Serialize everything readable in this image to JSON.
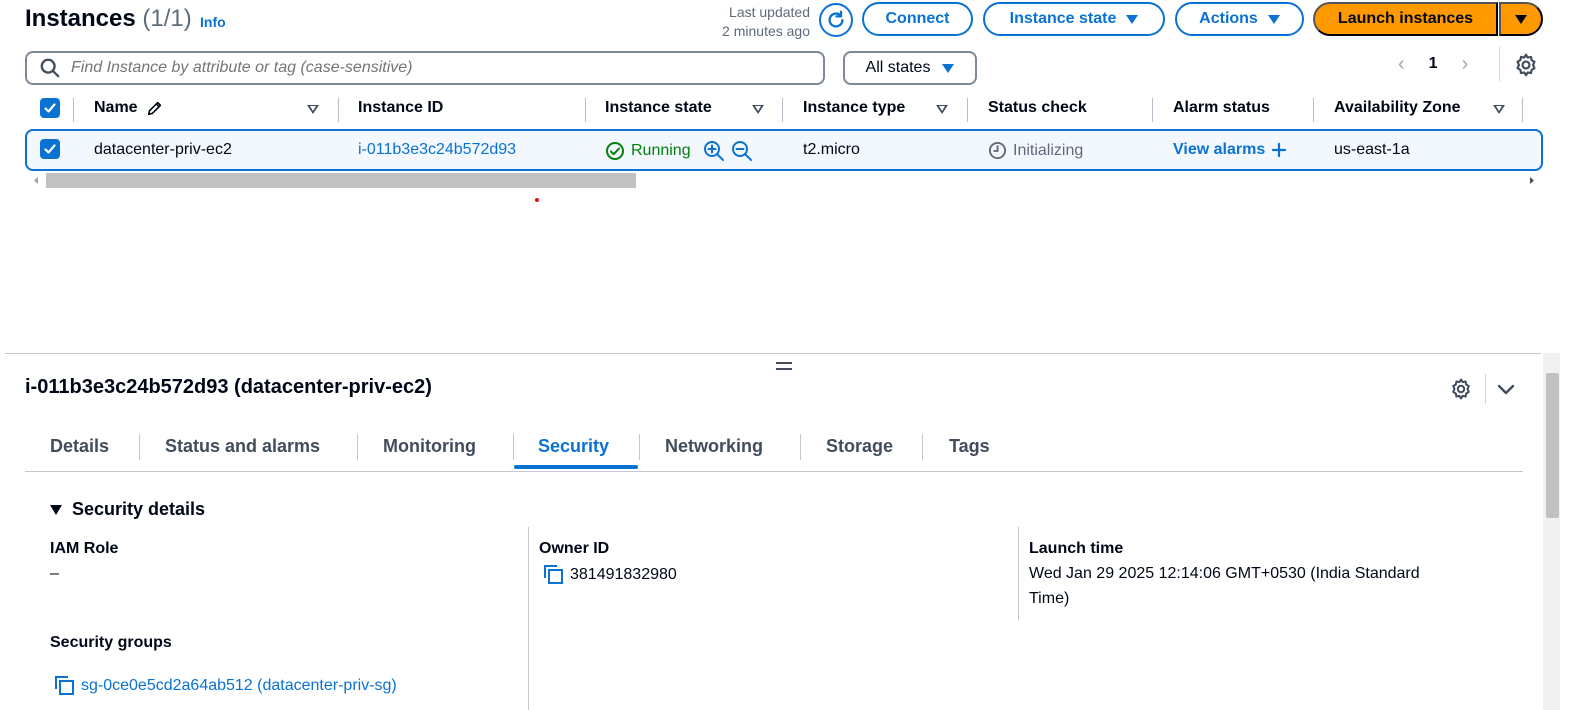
{
  "header": {
    "title": "Instances",
    "count": "(1/1)",
    "info": "Info",
    "last_updated_line1": "Last updated",
    "last_updated_line2": "2 minutes ago",
    "connect": "Connect",
    "instance_state": "Instance state",
    "actions": "Actions",
    "launch": "Launch instances"
  },
  "search": {
    "placeholder": "Find Instance by attribute or tag (case-sensitive)",
    "filter_value": "All states"
  },
  "pagination": {
    "current_page": "1"
  },
  "table": {
    "columns": [
      "Name",
      "Instance ID",
      "Instance state",
      "Instance type",
      "Status check",
      "Alarm status",
      "Availability Zone"
    ],
    "rows": [
      {
        "name": "datacenter-priv-ec2",
        "instance_id": "i-011b3e3c24b572d93",
        "state": "Running",
        "type": "t2.micro",
        "status_check": "Initializing",
        "alarm": "View alarms",
        "az": "us-east-1a"
      }
    ]
  },
  "details": {
    "title": "i-011b3e3c24b572d93 (datacenter-priv-ec2)",
    "tabs": [
      "Details",
      "Status and alarms",
      "Monitoring",
      "Security",
      "Networking",
      "Storage",
      "Tags"
    ],
    "active_tab": "Security",
    "section": "Security details",
    "iam_role_label": "IAM Role",
    "iam_role_value": "–",
    "owner_label": "Owner ID",
    "owner_value": "381491832980",
    "launch_label": "Launch time",
    "launch_value_1": "Wed Jan 29 2025 12:14:06 GMT+0530 (India Standard",
    "launch_value_2": "Time)",
    "sg_label": "Security groups",
    "sg_value": "sg-0ce0e5cd2a64ab512 (datacenter-priv-sg)"
  },
  "colors": {
    "accent": "#0972d3",
    "launch": "#ff9900",
    "running": "#037f0c"
  }
}
